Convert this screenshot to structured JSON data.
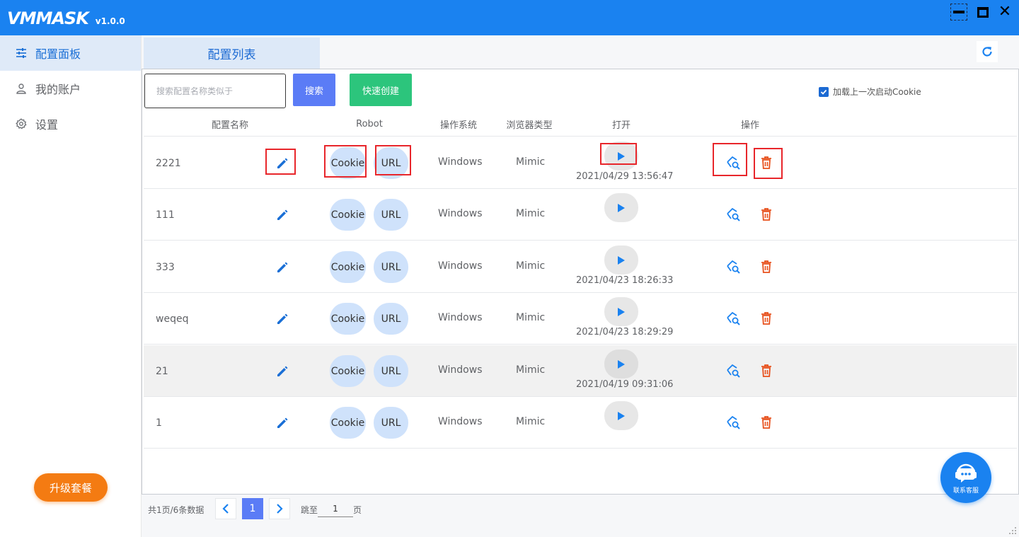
{
  "app": {
    "logo_text": "VMMASK",
    "version": "v1.0.0"
  },
  "window_controls": [
    "minimize-icon",
    "maximize-icon",
    "close-icon"
  ],
  "sidebar": {
    "items": [
      {
        "label": "配置面板",
        "icon": "sliders-icon",
        "active": true
      },
      {
        "label": "我的账户",
        "icon": "user-icon",
        "active": false
      },
      {
        "label": "设置",
        "icon": "gear-icon",
        "active": false
      }
    ],
    "upgrade_label": "升级套餐"
  },
  "tabs": [
    {
      "label": "配置列表",
      "active": true
    }
  ],
  "toolbar": {
    "search_placeholder": "搜索配置名称类似于",
    "search_value": "",
    "search_label": "搜索",
    "create_label": "快速创建",
    "load_cookie_label": "加载上一次启动Cookie",
    "load_cookie_checked": true
  },
  "table": {
    "columns": [
      "配置名称",
      "Robot",
      "操作系统",
      "浏览器类型",
      "打开",
      "操作"
    ],
    "cookie_label": "Cookie",
    "url_label": "URL",
    "rows": [
      {
        "name": "2221",
        "os": "Windows",
        "browser": "Mimic",
        "last_opened": "2021/04/29 13:56:47"
      },
      {
        "name": "111",
        "os": "Windows",
        "browser": "Mimic",
        "last_opened": ""
      },
      {
        "name": "333",
        "os": "Windows",
        "browser": "Mimic",
        "last_opened": "2021/04/23 18:26:33"
      },
      {
        "name": "weqeq",
        "os": "Windows",
        "browser": "Mimic",
        "last_opened": "2021/04/23 18:29:29"
      },
      {
        "name": "21",
        "os": "Windows",
        "browser": "Mimic",
        "last_opened": "2021/04/19 09:31:06"
      },
      {
        "name": "1",
        "os": "Windows",
        "browser": "Mimic",
        "last_opened": ""
      }
    ]
  },
  "pagination": {
    "summary": "共1页/6条数据",
    "current_page": "1",
    "goto_label": "跳至",
    "goto_value": "1",
    "page_suffix": "页"
  },
  "support": {
    "label": "联系客服"
  },
  "colors": {
    "primary": "#1a82f0",
    "search_button": "#5b7cf6",
    "create_button": "#2cc57c",
    "upgrade_button": "#f47b12",
    "delete_icon": "#e8501c",
    "annotation_box": "#e8262b"
  }
}
